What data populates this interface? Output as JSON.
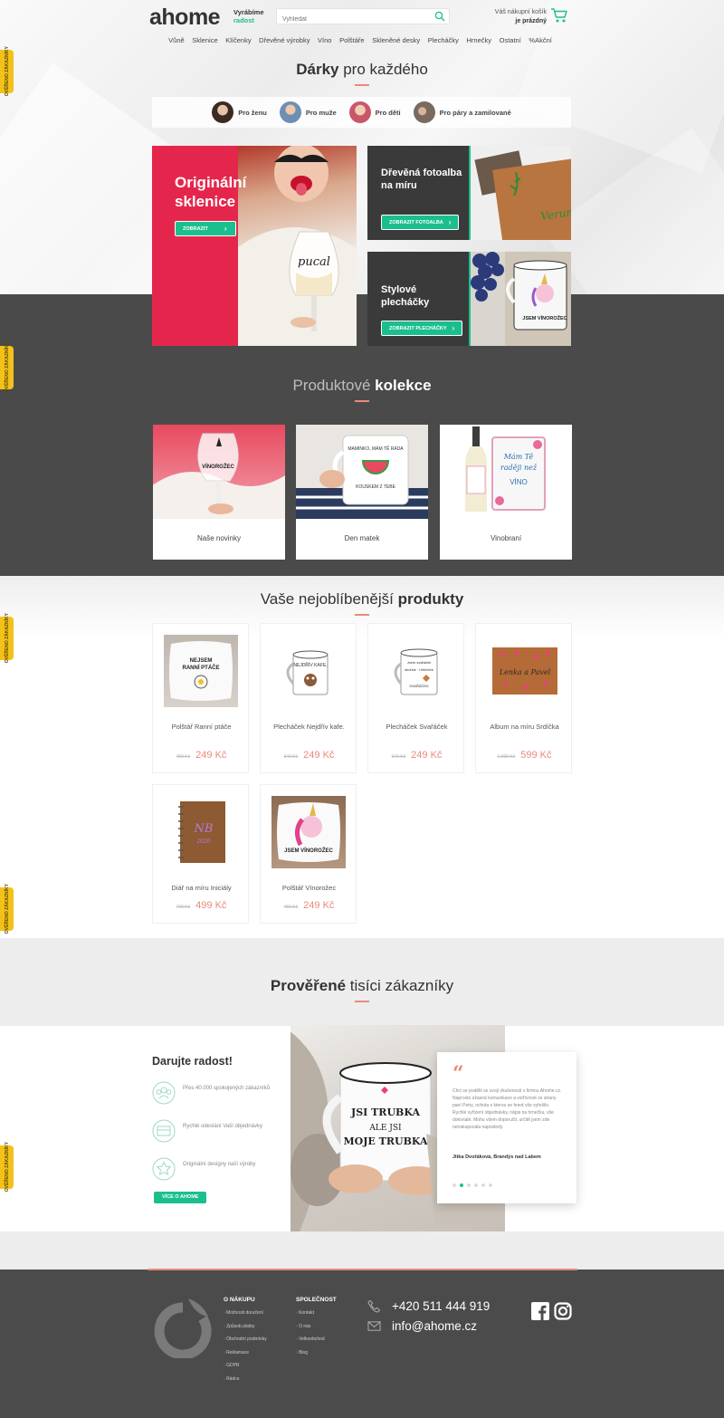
{
  "header": {
    "logo": "ahome",
    "tagline_line1": "Vyrábíme",
    "tagline_line2": "radost",
    "search_placeholder": "Vyhledat",
    "cart_line1": "Váš nákupní košík",
    "cart_line2": "je prázdný"
  },
  "nav": [
    "Vůně",
    "Sklenice",
    "Klíčenky",
    "Dřevěné výrobky",
    "Víno",
    "Polštáře",
    "Skleněné desky",
    "Plecháčky",
    "Hrnečky",
    "Ostatní",
    "%Akční"
  ],
  "side_badges": [
    "OVĚŘENO ZÁKAZNÍKY",
    "OVĚŘENO ZÁKAZNÍKY",
    "OVĚŘENO ZÁKAZNÍKY",
    "OVĚŘENO ZÁKAZNÍKY",
    "OVĚŘENO ZÁKAZNÍKY"
  ],
  "gifts": {
    "title_bold": "Dárky",
    "title_rest": " pro každého",
    "chips": [
      "Pro ženu",
      "Pro muže",
      "Pro děti",
      "Pro páry a zamilované"
    ]
  },
  "banners": {
    "big_title": "Originální sklenice",
    "big_button": "ZOBRAZIT",
    "big_glass_text": "pucal",
    "album_title": "Dřevěná fotoalba na míru",
    "album_button": "ZOBRAZIT FOTOALBA",
    "album_wood_text": "Verunce",
    "mug_title": "Stylové plecháčky",
    "mug_button": "ZOBRAZIT PLECHÁČKY",
    "mug_print_text": "JSEM VÍNOROŽEC"
  },
  "collections": {
    "title_rest": "Produktové ",
    "title_bold": "kolekce",
    "items": [
      "Naše novinky",
      "Den matek",
      "Vinobraní"
    ]
  },
  "products": {
    "title_rest": "Vaše nejoblíbenější ",
    "title_bold": "produkty",
    "items": [
      {
        "name": "Polštář Ranní ptáče",
        "old": "459 Kč",
        "price": "249 Kč"
      },
      {
        "name": "Plecháček Nejdřív kafe.",
        "old": "349 Kč",
        "price": "249 Kč"
      },
      {
        "name": "Plecháček Svařáček",
        "old": "349 Kč",
        "price": "249 Kč"
      },
      {
        "name": "Album na míru Srdíčka",
        "old": "1 099 Kč",
        "price": "599 Kč"
      },
      {
        "name": "Diář na míru Iniciály",
        "old": "799 Kč",
        "price": "499 Kč"
      },
      {
        "name": "Polštář Vínorožec",
        "old": "459 Kč",
        "price": "249 Kč"
      }
    ]
  },
  "testimonials": {
    "title_bold": "Prověřené",
    "title_rest": " tisíci zákazníky",
    "heading": "Darujte radost!",
    "features": [
      "Přes 40.000 spokojených zákazníků",
      "Rychlé odeslání Vaší objednávky",
      "Originální designy naší výroby"
    ],
    "button": "VÍCE O AHOME",
    "mug_text_1": "JSI TRUBKA",
    "mug_text_2": "ALE JSI",
    "mug_text_3": "MOJE TRUBKA",
    "quote_mark": "“",
    "quote": "Chci se podělit se svojí zkušeností s firmou Ahome.cz. Naprosto úžasná komunikace a vstřícnost ze strany paní Petry, ochota s kterou se hned vše vyřešilo. Rychlé vyřízení objednávky, nápis na hrnečku, vše dokonalé. Mohu všem doporučit, určitě jsem zde nenakupovala naposledy.",
    "author": "Jitka Dvořáková, Brandýs nad Labem"
  },
  "footer": {
    "col1_title": "O NÁKUPU",
    "col1_links": [
      "Možnosti doručení",
      "Způsob platby",
      "Obchodní podmínky",
      "Reklamace",
      "GDPR",
      "Rádce"
    ],
    "col2_title": "SPOLEČNOST",
    "col2_links": [
      "Kontakt",
      "O nás",
      "Velkoobchod",
      "Blog"
    ],
    "phone": "+420 511 444 919",
    "email": "info@ahome.cz"
  },
  "colors": {
    "accent_green": "#1bbf8e",
    "accent_coral": "#e98a7c",
    "badge_yellow": "#f2c21b",
    "banner_red": "#e5264c",
    "dark_bg": "#4a4a4a"
  }
}
